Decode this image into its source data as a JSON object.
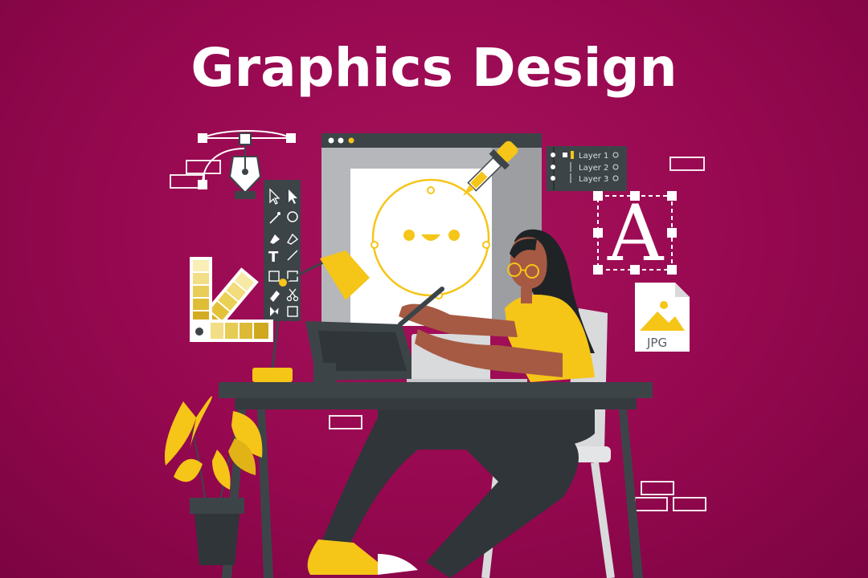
{
  "title": "Graphics Design",
  "layers_panel": {
    "layers": [
      {
        "label": "Layer 1"
      },
      {
        "label": "Layer 2"
      },
      {
        "label": "Layer 3"
      }
    ]
  },
  "type_preview": {
    "glyph": "A"
  },
  "toolbar": {
    "text_tool": "T"
  },
  "file_icon": {
    "label": "JPG"
  },
  "colors": {
    "background": "#95084f",
    "accent": "#f5c518",
    "dark": "#3d4448",
    "white": "#ffffff"
  },
  "icons": [
    "pen-tool-icon",
    "eyedropper-icon",
    "eye-icon",
    "lock-icon",
    "image-file-icon",
    "selection-arrow-icon",
    "scissors-icon",
    "pencil-icon",
    "magic-wand-icon"
  ]
}
